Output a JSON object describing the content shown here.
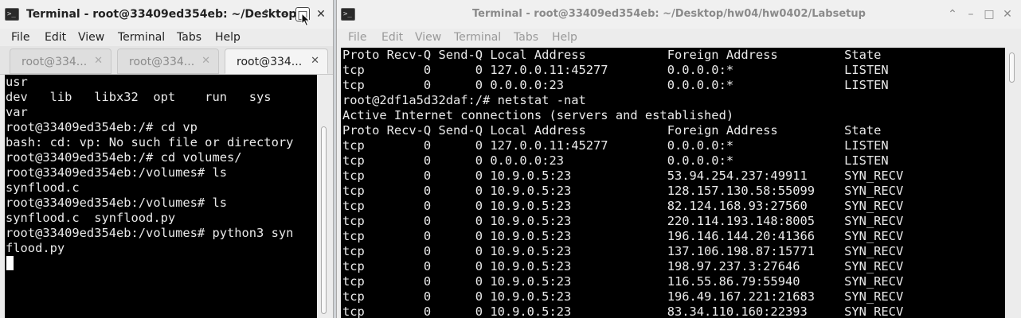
{
  "left_window": {
    "title": "Terminal - root@33409ed354eb: ~/Desktop",
    "controls": {
      "shade": "⌃",
      "minimize": "–",
      "maximize": "□",
      "close": "✕"
    },
    "menu": [
      "File",
      "Edit",
      "View",
      "Terminal",
      "Tabs",
      "Help"
    ],
    "tabs": [
      {
        "label": "root@334...",
        "close": "✕"
      },
      {
        "label": "root@334...",
        "close": "✕"
      },
      {
        "label": "root@334...",
        "close": "✕"
      }
    ],
    "active_tab": 2,
    "terminal_lines": [
      "usr",
      "dev   lib   libx32  opt    run   sys",
      "var",
      "root@33409ed354eb:/# cd vp",
      "bash: cd: vp: No such file or directory",
      "root@33409ed354eb:/# cd volumes/",
      "root@33409ed354eb:/volumes# ls",
      "synflood.c",
      "root@33409ed354eb:/volumes# ls",
      "synflood.c  synflood.py",
      "root@33409ed354eb:/volumes# python3 syn",
      "flood.py"
    ]
  },
  "right_window": {
    "title": "Terminal - root@33409ed354eb: ~/Desktop/hw04/hw0402/Labsetup",
    "controls": {
      "shade": "⌃",
      "minimize": "–",
      "maximize": "□",
      "close": "✕"
    },
    "menu": [
      "File",
      "Edit",
      "View",
      "Terminal",
      "Tabs",
      "Help"
    ],
    "terminal_lines": [
      "Proto Recv-Q Send-Q Local Address           Foreign Address         State",
      "tcp        0      0 127.0.0.11:45277        0.0.0.0:*               LISTEN",
      "tcp        0      0 0.0.0.0:23              0.0.0.0:*               LISTEN",
      "root@2df1a5d32daf:/# netstat -nat",
      "Active Internet connections (servers and established)",
      "Proto Recv-Q Send-Q Local Address           Foreign Address         State",
      "tcp        0      0 127.0.0.11:45277        0.0.0.0:*               LISTEN",
      "tcp        0      0 0.0.0.0:23              0.0.0.0:*               LISTEN",
      "tcp        0      0 10.9.0.5:23             53.94.254.237:49911     SYN_RECV",
      "tcp        0      0 10.9.0.5:23             128.157.130.58:55099    SYN_RECV",
      "tcp        0      0 10.9.0.5:23             82.124.168.93:27560     SYN_RECV",
      "tcp        0      0 10.9.0.5:23             220.114.193.148:8005    SYN_RECV",
      "tcp        0      0 10.9.0.5:23             196.146.144.20:41366    SYN_RECV",
      "tcp        0      0 10.9.0.5:23             137.106.198.87:15771    SYN_RECV",
      "tcp        0      0 10.9.0.5:23             198.97.237.3:27646      SYN_RECV",
      "tcp        0      0 10.9.0.5:23             116.55.86.79:55940      SYN_RECV",
      "tcp        0      0 10.9.0.5:23             196.49.167.221:21683    SYN_RECV",
      "tcp        0      0 10.9.0.5:23             83.34.110.160:22393     SYN_RECV"
    ]
  },
  "colors": {
    "terminal_bg": "#000000",
    "terminal_fg": "#eaeaea",
    "chrome_bg": "#ececec",
    "inactive_text": "#8a8a8a"
  }
}
